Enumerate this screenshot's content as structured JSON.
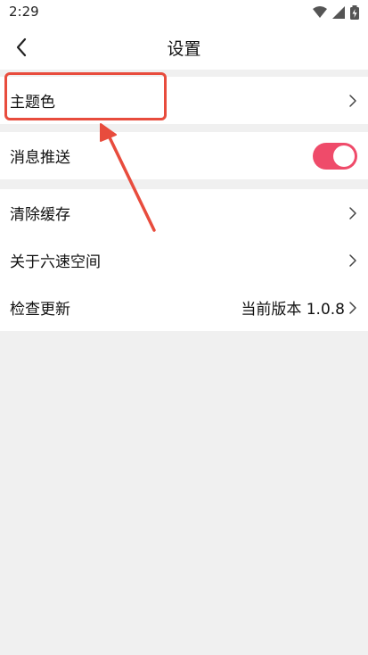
{
  "status_bar": {
    "time": "2:29"
  },
  "header": {
    "title": "设置"
  },
  "settings": {
    "theme_color": "主题色",
    "push_notifications": "消息推送",
    "clear_cache": "清除缓存",
    "about": "关于六速空间",
    "check_update": "检查更新",
    "current_version": "当前版本 1.0.8"
  },
  "toggle_state": {
    "push_notifications_enabled": true,
    "accent_color": "#ef4b6a"
  },
  "annotation": {
    "highlight_color": "#e84c3d"
  }
}
